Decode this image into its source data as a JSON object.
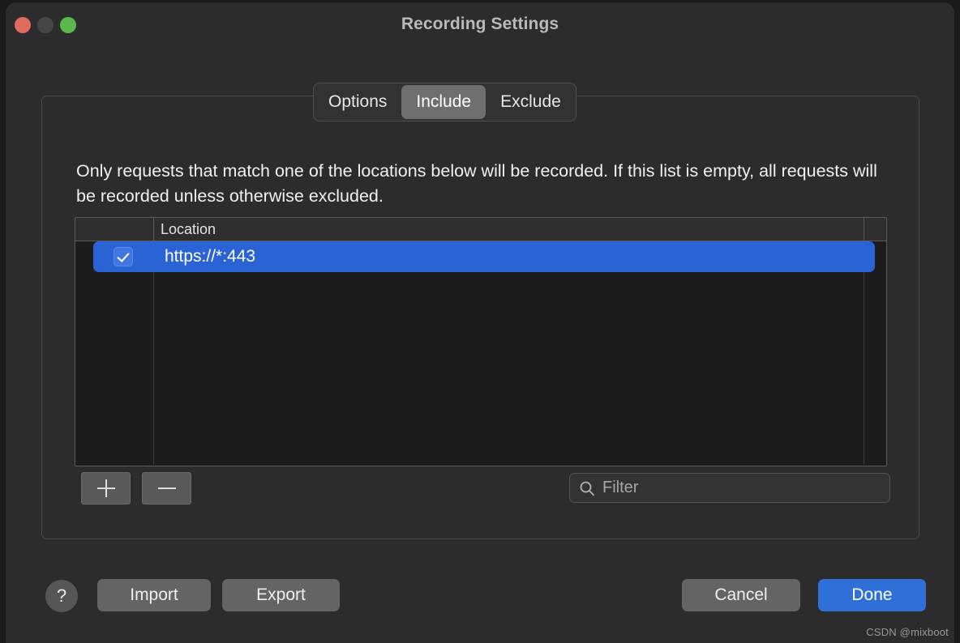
{
  "window": {
    "title": "Recording Settings",
    "traffic_lights": [
      "close-button",
      "minimize-button",
      "zoom-button"
    ]
  },
  "tabs": [
    {
      "label": "Options",
      "active": false
    },
    {
      "label": "Include",
      "active": true
    },
    {
      "label": "Exclude",
      "active": false
    }
  ],
  "description": "Only requests that match one of the locations below will be recorded. If this list is empty, all requests will be recorded unless otherwise excluded.",
  "table": {
    "columns": [
      "",
      "Location",
      ""
    ],
    "rows": [
      {
        "checked": true,
        "location": "https://*:443",
        "selected": true
      }
    ]
  },
  "toolbar": {
    "add_label": "+",
    "remove_label": "—",
    "filter_placeholder": "Filter",
    "filter_value": ""
  },
  "footer": {
    "help_label": "?",
    "import_label": "Import",
    "export_label": "Export",
    "cancel_label": "Cancel",
    "done_label": "Done"
  },
  "watermark": "CSDN @mixboot",
  "colors": {
    "window_bg": "#2c2c2c",
    "accent_blue": "#2f6fd8",
    "selection_blue": "#2a63d4",
    "tab_active": "#6e6e6e",
    "table_bg": "#1c1c1c",
    "table_header_bg": "#2e2e2e"
  }
}
